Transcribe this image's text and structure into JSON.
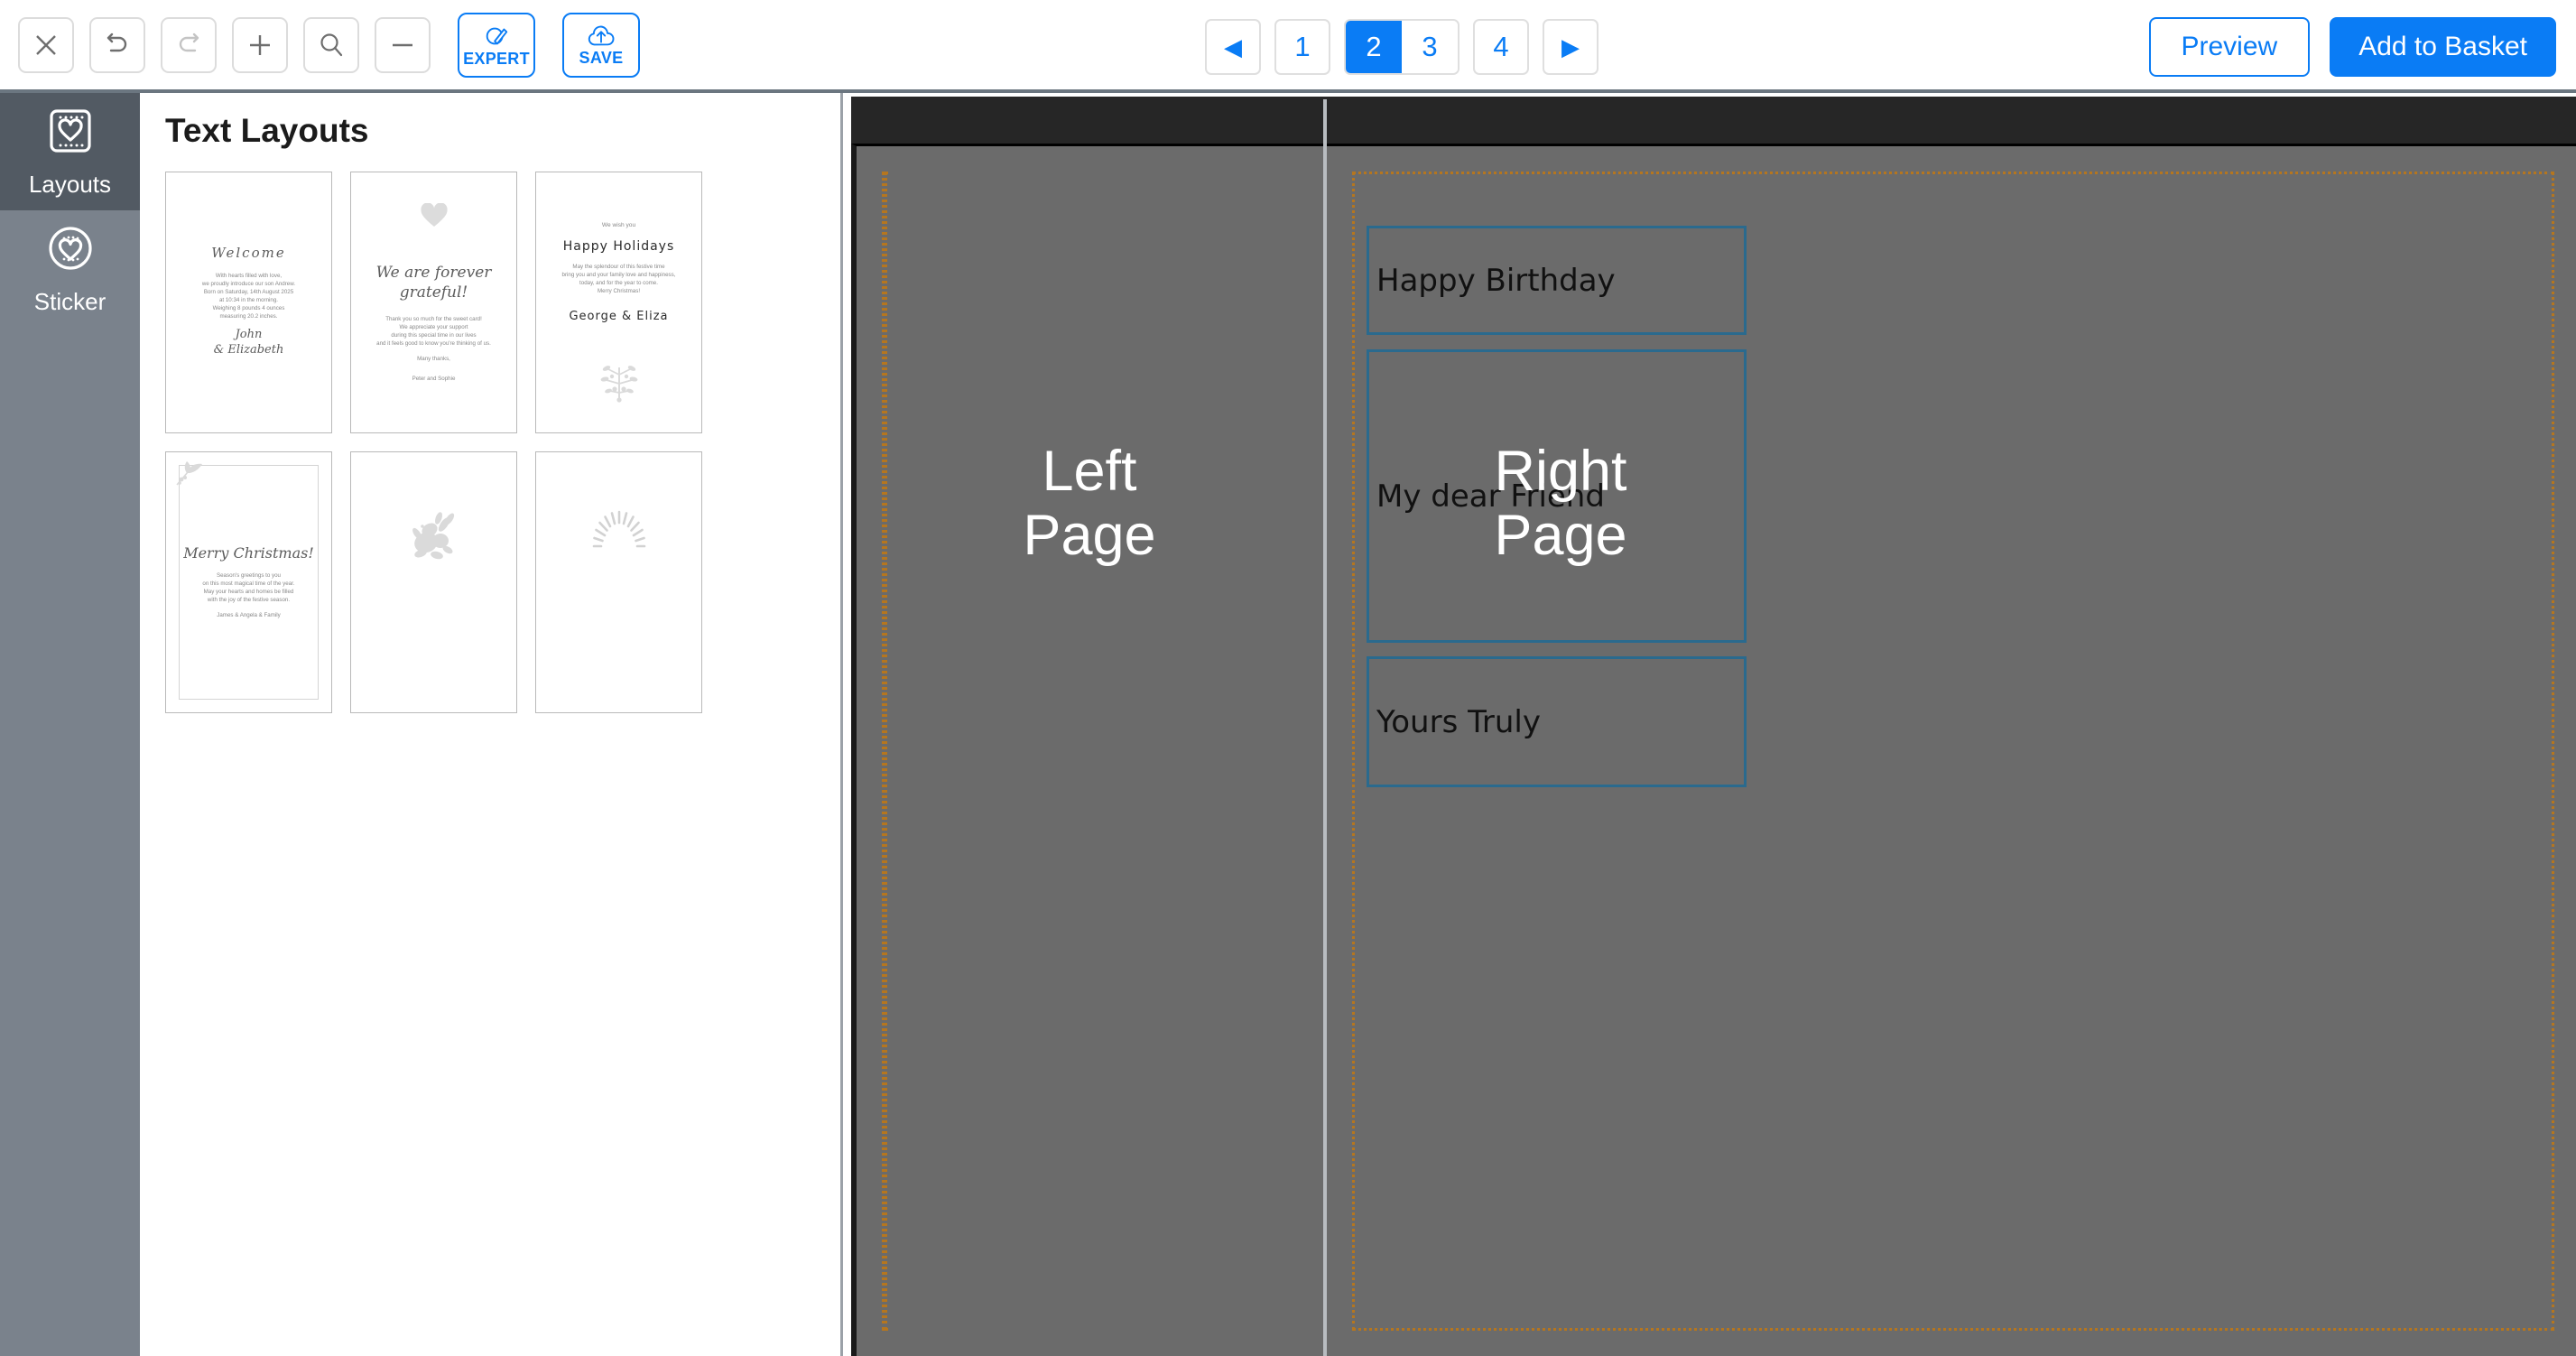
{
  "toolbar": {
    "buttons": [
      {
        "name": "close-button",
        "icon": "close-icon",
        "label": ""
      },
      {
        "name": "undo-button",
        "icon": "undo-icon",
        "label": ""
      },
      {
        "name": "redo-button",
        "icon": "redo-icon",
        "label": ""
      },
      {
        "name": "zoom-in-button",
        "icon": "plus-icon",
        "label": ""
      },
      {
        "name": "search-button",
        "icon": "search-icon",
        "label": ""
      },
      {
        "name": "zoom-out-button",
        "icon": "minus-icon",
        "label": ""
      }
    ],
    "expert_label": "EXPERT",
    "save_label": "SAVE",
    "accent_color": "#0a7cf5"
  },
  "pagination": {
    "prev_label": "◀",
    "next_label": "▶",
    "pages": [
      "1",
      "2",
      "3",
      "4"
    ],
    "active_page": "2",
    "active_color": "#0a7cf5"
  },
  "actions": {
    "preview_label": "Preview",
    "add_to_basket_label": "Add to Basket"
  },
  "rail": {
    "items": [
      {
        "label": "Layouts",
        "icon": "layouts-heart-frame-icon",
        "active": true
      },
      {
        "label": "Sticker",
        "icon": "sticker-heart-circle-icon",
        "active": false
      }
    ]
  },
  "panel": {
    "title": "Text Layouts",
    "layouts": [
      {
        "id": "welcome-baby",
        "script_title": "Welcome",
        "body": [
          "With hearts filled with love,",
          "we proudly introduce our son Andrew.",
          "Born on Saturday, 14th August 2025",
          "at 10:34 in the morning.",
          "Weighing 8 pounds 4 ounces",
          "measuring 20.2 inches."
        ],
        "signature": [
          "John",
          "& Elizabeth"
        ]
      },
      {
        "id": "forever-grateful",
        "script_title": [
          "We are forever",
          "grateful!"
        ],
        "body": [
          "Thank you so much for the sweet card!",
          "We appreciate your support",
          "during this special time in our lives",
          "and it feels good to know you're thinking of us."
        ],
        "closing": "Many thanks,",
        "signature": "Peter and Sophie",
        "decoration": "heart-icon"
      },
      {
        "id": "happy-holidays",
        "intro": "We wish you",
        "hand_title": "Happy Holidays",
        "body": [
          "May the splendour of this festive time",
          "bring you and your family love and happiness,",
          "today, and for the year to come.",
          "Merry Christmas!"
        ],
        "signature": "George & Eliza",
        "decoration": "mistletoe-sprig-icon"
      },
      {
        "id": "merry-christmas",
        "script_title": "Merry Christmas!",
        "body": [
          "Season's greetings to you",
          "on this most magical time of the year.",
          "May your hearts and homes be filled",
          "with the joy of the festive season."
        ],
        "signature": "James & Angela & Family",
        "decoration": "holly-sprig-icon"
      },
      {
        "id": "floral-blank",
        "decoration": "floral-bouquet-icon"
      },
      {
        "id": "sunburst-blank",
        "decoration": "sunburst-rays-icon"
      }
    ]
  },
  "canvas": {
    "left_page_label": "Left\nPage",
    "left_page_line1": "Left",
    "left_page_line2": "Page",
    "right_page_line1": "Right",
    "right_page_line2": "Page",
    "guide_color": "#b5761f",
    "page_background": "#6b6b6b",
    "textbox_border_color": "#2a6a8e",
    "text_boxes": [
      {
        "name": "greeting-textbox",
        "value": "Happy Birthday"
      },
      {
        "name": "message-textbox",
        "value": "My dear Friend"
      },
      {
        "name": "signoff-textbox",
        "value": "Yours Truly"
      }
    ]
  }
}
